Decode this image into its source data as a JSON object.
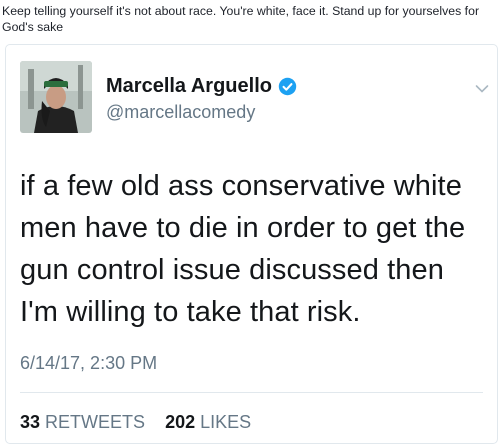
{
  "caption": "Keep telling yourself it's not about race. You're white, face it. Stand up for yourselves for God's sake",
  "tweet": {
    "author_name": "Marcella Arguello",
    "handle": "@marcellacomedy",
    "verified_icon": "verified-badge-icon",
    "menu_icon": "chevron-down-icon",
    "text": "if a few old ass conservative white men have to die in order to get the gun control issue discussed then I'm willing to take that risk.",
    "timestamp": "6/14/17, 2:30 PM",
    "retweets_count": "33",
    "retweets_label": "RETWEETS",
    "likes_count": "202",
    "likes_label": "LIKES"
  },
  "colors": {
    "verified": "#1da1f2",
    "muted": "#657786",
    "border": "#e1e8ed"
  }
}
